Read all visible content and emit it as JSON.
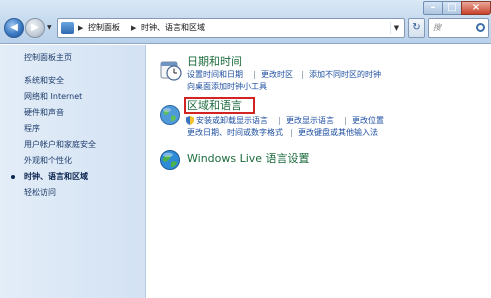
{
  "window": {
    "minimize_glyph": "–",
    "maximize_glyph": "□",
    "close_glyph": "×"
  },
  "nav": {
    "back_glyph": "◀",
    "forward_glyph": "▶",
    "dropdown_glyph": "▼",
    "refresh_glyph": "↻"
  },
  "address": {
    "icon": "control-panel-icon",
    "separator": "▶",
    "crumbs": [
      "控制面板",
      "时钟、语言和区域"
    ],
    "dropdown_glyph": "▼"
  },
  "search": {
    "placeholder": "搜"
  },
  "sidebar": {
    "items": [
      "控制面板主页",
      "系统和安全",
      "网络和 Internet",
      "硬件和声音",
      "程序",
      "用户帐户和家庭安全",
      "外观和个性化",
      "时钟、语言和区域",
      "轻松访问"
    ],
    "current_index": 7
  },
  "categories": [
    {
      "title": "日期和时间",
      "icon": "clock-calendar-icon",
      "links": [
        "设置时间和日期",
        "更改时区",
        "添加不同时区的时钟",
        "向桌面添加时钟小工具"
      ]
    },
    {
      "title": "区域和语言",
      "icon": "globe-icon",
      "highlighted": true,
      "links": [
        "安装或卸载显示语言",
        "更改显示语言",
        "更改位置",
        "更改日期、时间或数字格式",
        "更改键盘或其他输入法"
      ]
    },
    {
      "title": "Windows Live 语言设置",
      "icon": "windows-live-globe-icon",
      "links": []
    }
  ],
  "colors": {
    "category_title": "#1c6b3d",
    "link": "#1e4fa1",
    "highlight_border": "#d32424",
    "sidebar_bg": "#dce8f5"
  }
}
